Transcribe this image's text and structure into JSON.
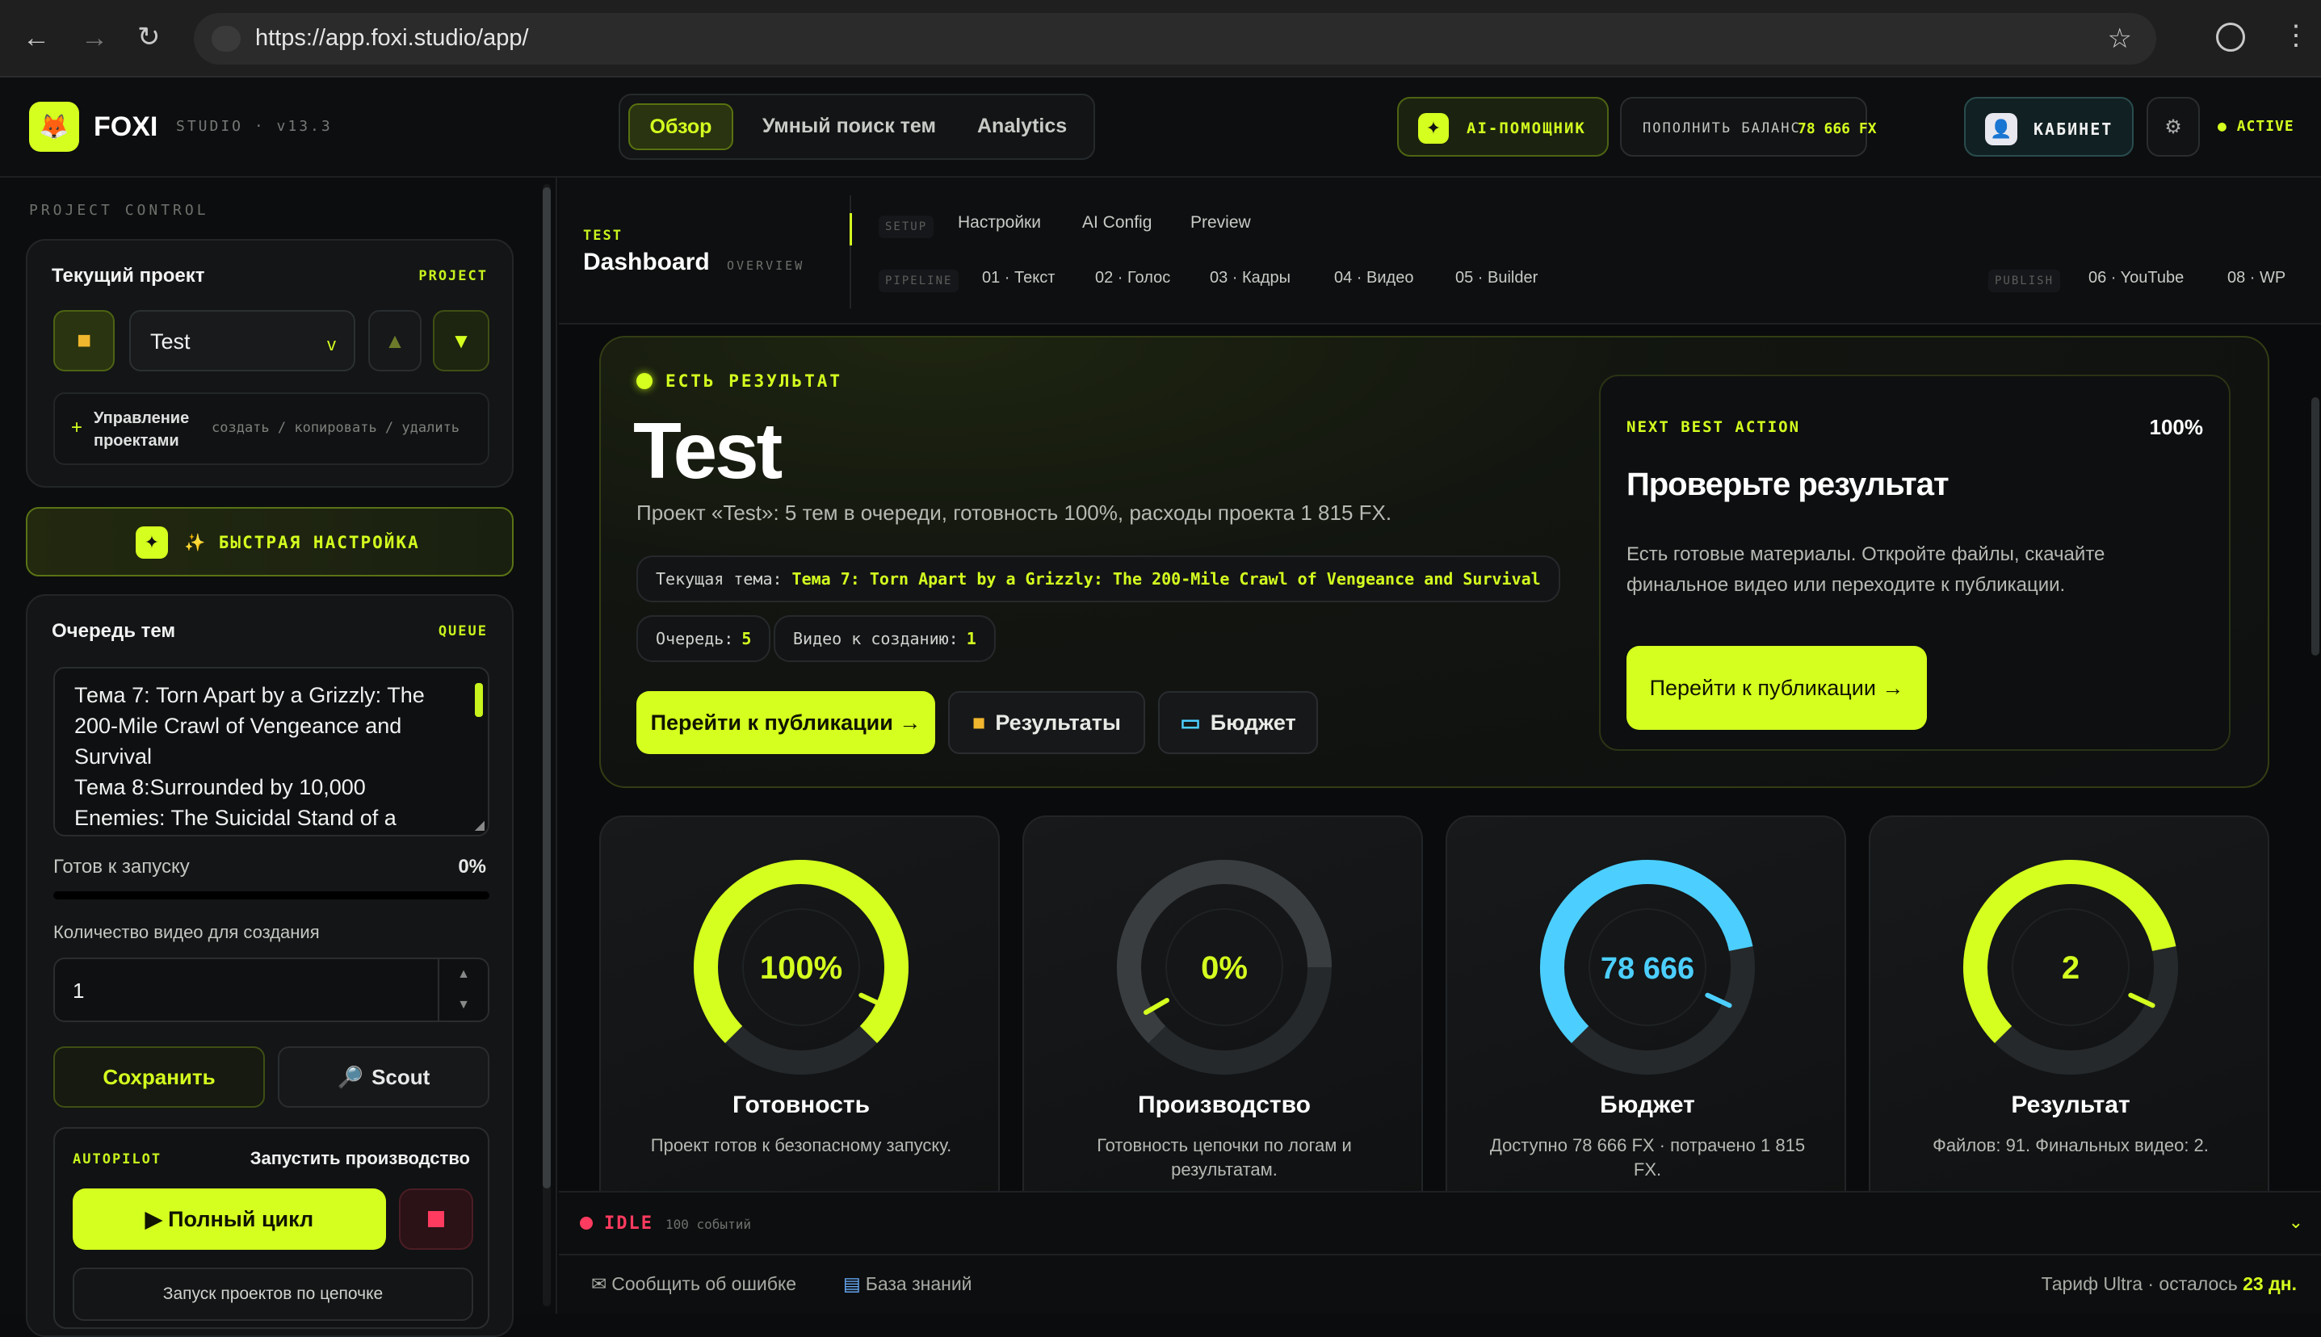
{
  "browser": {
    "url": "https://app.foxi.studio/app/"
  },
  "header": {
    "brand": "FOXI",
    "studio": "STUDIO · v13.3",
    "tabs": [
      "Обзор",
      "Умный поиск тем",
      "Analytics"
    ],
    "ai_label": "AI-ПОМОЩНИК",
    "balance_label": "ПОПОЛНИТЬ БАЛАНС",
    "balance_value": "78 666 FX",
    "cabinet": "КАБИНЕТ",
    "active": "ACTIVE"
  },
  "sidebar": {
    "section": "PROJECT CONTROL",
    "current_project_label": "Текущий проект",
    "project_tag": "PROJECT",
    "project_value": "Test",
    "manage_title": "Управление проектами",
    "manage_actions": "создать / копировать / удалить",
    "quick_setup": "✨ БЫСТРАЯ НАСТРОЙКА",
    "queue_title": "Очередь тем",
    "queue_tag": "QUEUE",
    "queue_text": "Тема 7: Torn Apart by a Grizzly: The 200-Mile Crawl of Vengeance and Survival\nТема 8:Surrounded by 10,000 Enemies: The Suicidal Stand of a",
    "ready_label": "Готов к запуску",
    "ready_pct": "0%",
    "ready_fraction": 0,
    "count_label": "Количество видео для создания",
    "count_value": "1",
    "save": "Сохранить",
    "scout": "Scout",
    "autopilot": "AUTOPILOT",
    "run_production": "Запустить производство",
    "full_cycle": "▶ Полный цикл",
    "chain": "Запуск проектов по цепочке"
  },
  "subnav": {
    "tag": "TEST",
    "title": "Dashboard",
    "overview": "OVERVIEW",
    "setup": "SETUP",
    "setup_items": [
      "Настройки",
      "AI Config",
      "Preview"
    ],
    "pipeline": "PIPELINE",
    "pipeline_items": [
      "01 · Текст",
      "02 · Голос",
      "03 · Кадры",
      "04 · Видео",
      "05 · Builder"
    ],
    "publish": "PUBLISH",
    "publish_items": [
      "06 · YouTube",
      "08 · WP"
    ]
  },
  "hero": {
    "status": "ЕСТЬ РЕЗУЛЬТАТ",
    "title": "Test",
    "desc": "Проект «Test»: 5 тем в очереди, готовность 100%, расходы проекта 1 815 FX.",
    "topic_label": "Текущая тема:",
    "topic_value": "Тема 7: Torn Apart by a Grizzly: The 200-Mile Crawl of Vengeance and Survival",
    "queue_label": "Очередь:",
    "queue_value": "5",
    "videos_label": "Видео к созданию:",
    "videos_value": "1",
    "btn_publish": "Перейти к публикации →",
    "btn_results": "Результаты",
    "btn_budget": "Бюджет"
  },
  "nba": {
    "tag": "NEXT BEST ACTION",
    "pct": "100%",
    "title": "Проверьте результат",
    "desc": "Есть готовые материалы. Откройте файлы, скачайте финальное видео или переходите к публикации.",
    "btn": "Перейти к публикации →"
  },
  "gauges": [
    {
      "value": "100%",
      "fraction": 1.0,
      "title": "Готовность",
      "desc": "Проект готов к безопасному запуску.",
      "color": "#d4ff1f"
    },
    {
      "value": "0%",
      "fraction": 0.0,
      "title": "Производство",
      "desc": "Готовность цепочки по логам и результатам.",
      "color": "#3a3d3f"
    },
    {
      "value": "78 666",
      "fraction": 0.75,
      "title": "Бюджет",
      "desc": "Доступно 78 666 FX · потрачено 1 815 FX.",
      "color": "#4ccfff"
    },
    {
      "value": "2",
      "fraction": 0.75,
      "title": "Результат",
      "desc": "Файлов: 91. Финальных видео: 2.",
      "color": "#d4ff1f"
    }
  ],
  "status": {
    "idle": "IDLE",
    "events": "100 событий"
  },
  "footer": {
    "report": "Сообщить об ошибке",
    "kb": "База знаний",
    "tariff": "Тариф Ultra · осталось",
    "days": "23 дн."
  }
}
